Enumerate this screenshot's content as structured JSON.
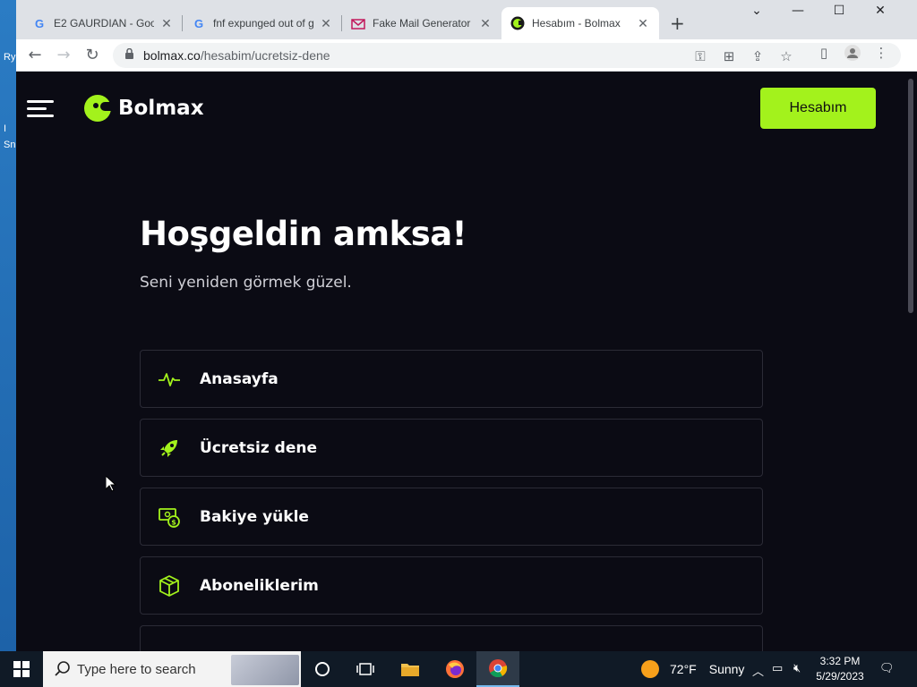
{
  "desktop": {
    "labels": [
      "Ry",
      "I",
      "Sn"
    ]
  },
  "browser": {
    "tabs": [
      {
        "favicon": "google-g-icon",
        "title": "E2 GAURDIAN - Goog",
        "close": "✕"
      },
      {
        "favicon": "google-g-icon",
        "title": "fnf expunged out of g",
        "close": "✕"
      },
      {
        "favicon": "mail-envelope-icon",
        "title": "Fake Mail Generator",
        "close": "✕"
      },
      {
        "favicon": "bolmax-icon",
        "title": "Hesabım - Bolmax",
        "close": "✕"
      }
    ],
    "new_tab": "+",
    "window_controls": {
      "list": "⌄",
      "minimize": "—",
      "maximize": "☐",
      "close": "✕"
    },
    "url_host": "bolmax.co",
    "url_path": "/hesabim/ucretsiz-dene"
  },
  "site": {
    "brand": "Bolmax",
    "account_button": "Hesabım",
    "welcome": "Hoşgeldin amksa!",
    "subtitle": "Seni yeniden görmek güzel.",
    "accent_color": "#a3f21c",
    "menu": [
      {
        "icon": "activity-pulse-icon",
        "label": "Anasayfa"
      },
      {
        "icon": "rocket-icon",
        "label": "Ücretsiz dene"
      },
      {
        "icon": "money-add-icon",
        "label": "Bakiye yükle"
      },
      {
        "icon": "box-package-icon",
        "label": "Aboneliklerim"
      }
    ]
  },
  "taskbar": {
    "search_placeholder": "Type here to search",
    "weather_temp": "72°F",
    "weather_text": "Sunny",
    "time": "3:32 PM",
    "date": "5/29/2023"
  }
}
